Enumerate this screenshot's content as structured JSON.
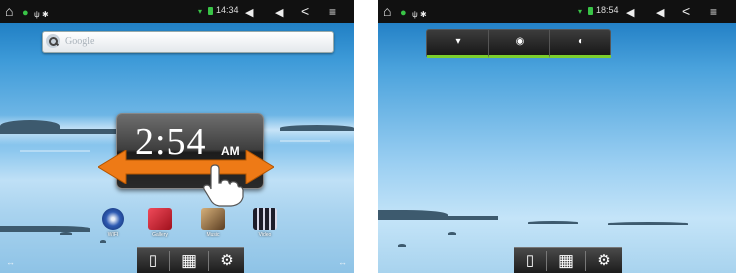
{
  "left_screen": {
    "status": {
      "home_icon": "home-icon",
      "time": "14:34",
      "back_icon": "back-icon",
      "volume_down_icon": "volume-down-icon",
      "volume_up_icon": "volume-up-icon",
      "menu_icon": "menu-icon"
    },
    "search": {
      "placeholder": "Google"
    },
    "clock": {
      "time": "2:54",
      "ampm": "AM"
    },
    "apps": [
      {
        "label": "WIFI",
        "icon": "wifi-icon",
        "color": "#1e3a7a"
      },
      {
        "label": "Gallery",
        "icon": "gallery-icon",
        "color": "#c21c2a"
      },
      {
        "label": "Music",
        "icon": "music-icon",
        "color": "#6b4a2a"
      },
      {
        "label": "Video",
        "icon": "video-icon",
        "color": "#3b3b55"
      }
    ],
    "dock": {
      "left_arrows": "↔",
      "right_arrows": "↔"
    }
  },
  "right_screen": {
    "status": {
      "time": "18:54"
    },
    "quick_settings": [
      {
        "icon": "wifi-toggle-icon"
      },
      {
        "icon": "rotation-toggle-icon"
      },
      {
        "icon": "brightness-toggle-icon"
      }
    ]
  },
  "colors": {
    "status_bar": "#111111",
    "accent_green": "#7ccf2e",
    "sky_top": "#0f6fb8"
  }
}
